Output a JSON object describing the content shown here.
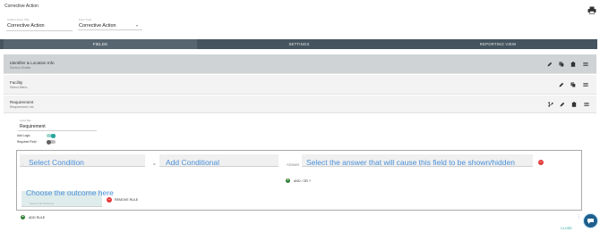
{
  "window": {
    "title": "Corrective Action"
  },
  "header": {
    "form_name_label": "Custom Form Title",
    "form_name_value": "Corrective Action",
    "form_type_label": "Form Type",
    "form_type_value": "Corrective Action"
  },
  "tabs": [
    {
      "label": "FIELDS"
    },
    {
      "label": "SETTINGS"
    },
    {
      "label": "REPORTING VIEW"
    }
  ],
  "fields": [
    {
      "title": "Identifier & Location Info",
      "subtitle": "Section Divider"
    },
    {
      "title": "Facility",
      "subtitle": "Select Menu"
    },
    {
      "title": "Requirement",
      "subtitle": "Requirement List"
    }
  ],
  "editor": {
    "field_label_caption": "Field Title",
    "field_label_value": "Requirement",
    "add_logic_label": "Add Logic",
    "required_label": "Required Field"
  },
  "condition": {
    "select_placeholder": "Select Condition",
    "is_text": "is",
    "conditional_placeholder": "Add Conditional",
    "answer_label": "Answer",
    "answer_hint": "Select the answer that will cause this field to be shown/hidden",
    "and_or_label": "AND / OR ?",
    "outcome_hint": "Choose the outcome here",
    "outcome_placeholder": "Select rule Outcome",
    "remove_rule_label": "REMOVE RULE"
  },
  "footer": {
    "add_rule_label": "ADD RULE",
    "close_label": "CLOSE"
  },
  "colors": {
    "tab_bar": "#45545f",
    "hint_blue": "#4a90d9",
    "danger": "#e23a3a",
    "success": "#2e7d32",
    "toggle_accent": "#26a69a",
    "chat_fab": "#1e5f8c"
  },
  "icons": [
    "print-icon",
    "pencil-icon",
    "copy-icon",
    "clipboard-icon",
    "drag-handle-icon",
    "branch-icon",
    "remove-icon",
    "add-icon",
    "chat-icon"
  ]
}
